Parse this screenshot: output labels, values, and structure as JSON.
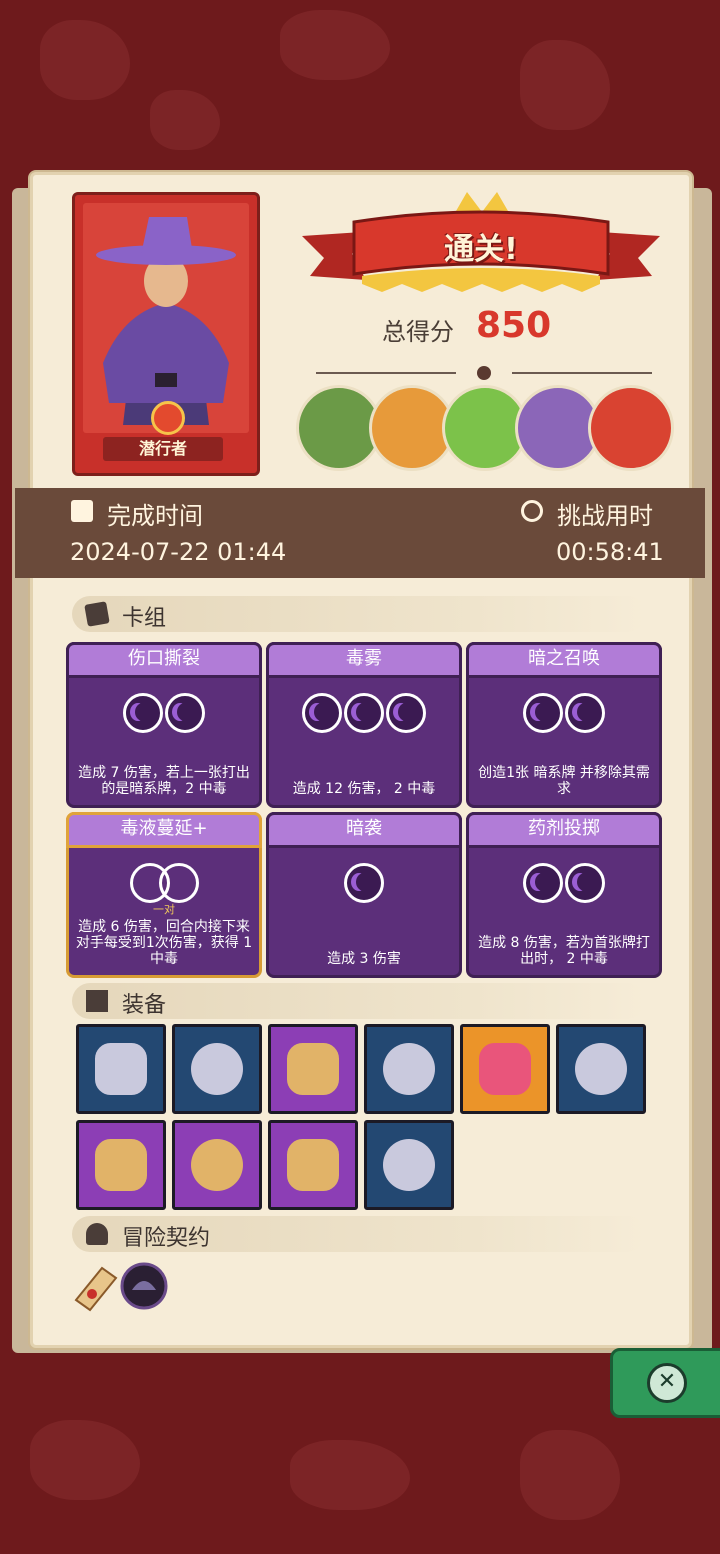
{
  "hero": {
    "name": "潜行者"
  },
  "result": {
    "banner": "通关!",
    "score_label": "总得分",
    "score": "850"
  },
  "bosses": [
    {
      "icon": "green-knight-boss-icon",
      "color": "#6b9a47"
    },
    {
      "icon": "ogre-boss-icon",
      "color": "#e79a3a"
    },
    {
      "icon": "goblin-king-boss-icon",
      "color": "#7cc24a"
    },
    {
      "icon": "purple-dragon-boss-icon",
      "color": "#8b66b8"
    },
    {
      "icon": "fire-demon-boss-icon",
      "color": "#d94331"
    }
  ],
  "time": {
    "finish_label": "完成时间",
    "finish_value": "2024-07-22 01:44",
    "challenge_label": "挑战用时",
    "challenge_value": "00:58:41"
  },
  "deck": {
    "title": "卡组",
    "cards": [
      {
        "name": "伤口撕裂",
        "cost": 2,
        "desc": "造成 7 伤害，若上一张打出的是暗系牌，2 中毒"
      },
      {
        "name": "毒雾",
        "cost": 3,
        "desc": "造成 12 伤害， 2 中毒"
      },
      {
        "name": "暗之召唤",
        "cost": 2,
        "desc": "创造1张 暗系牌 并移除其需求"
      },
      {
        "name": "毒液蔓延+",
        "cost": 0,
        "pair_label": "一对",
        "desc": "造成 6 伤害，回合内接下来对手每受到1次伤害，获得 1 中毒"
      },
      {
        "name": "暗袭",
        "cost": 1,
        "desc": "造成 3 伤害"
      },
      {
        "name": "药剂投掷",
        "cost": 2,
        "desc": "造成 8 伤害，若为首张牌打出时， 2 中毒"
      }
    ]
  },
  "equipment": {
    "title": "装备",
    "items": [
      {
        "icon": "horned-skull-icon",
        "rarity": "blue"
      },
      {
        "icon": "purple-splash-icon",
        "rarity": "blue"
      },
      {
        "icon": "jade-mask-icon",
        "rarity": "purple"
      },
      {
        "icon": "scythe-icon",
        "rarity": "blue"
      },
      {
        "icon": "fire-orb-icon",
        "rarity": "orange"
      },
      {
        "icon": "skull-tome-icon",
        "rarity": "blue"
      },
      {
        "icon": "green-leaves-icon",
        "rarity": "purple"
      },
      {
        "icon": "golden-book-icon",
        "rarity": "purple"
      },
      {
        "icon": "serpent-icon",
        "rarity": "purple"
      },
      {
        "icon": "horn-cup-icon",
        "rarity": "blue"
      }
    ]
  },
  "contract": {
    "title": "冒险契约",
    "items": [
      {
        "icon": "scroll-icon"
      },
      {
        "icon": "dark-helmet-icon"
      }
    ]
  },
  "colors": {
    "background": "#6e1a1c",
    "panel": "#f6ecd7",
    "card": "#5c2f7a",
    "score": "#d8382c"
  }
}
